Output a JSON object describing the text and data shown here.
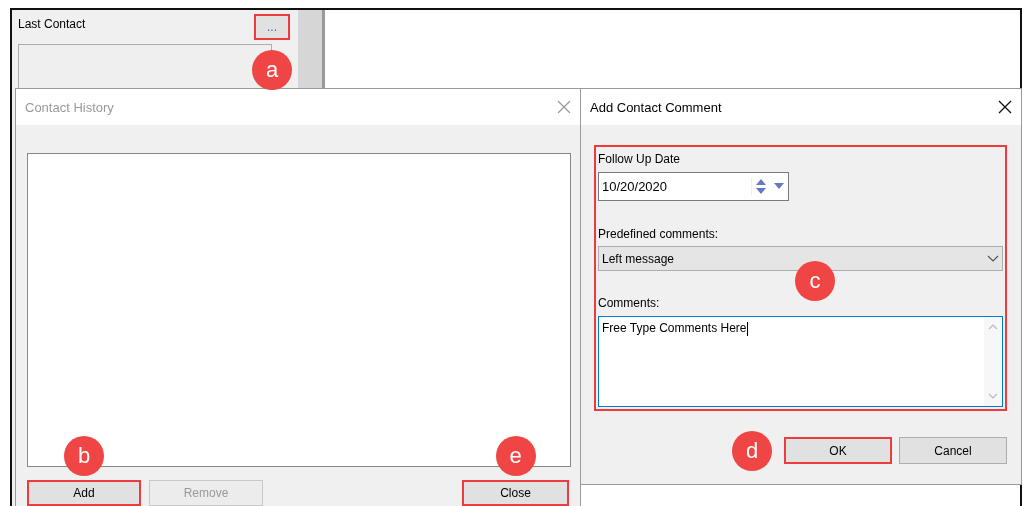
{
  "background_window": {
    "last_contact": {
      "label": "Last Contact",
      "button": {
        "label": "...",
        "highlighted": true,
        "callout": "a"
      }
    }
  },
  "contact_history": {
    "title": "Contact History",
    "buttons": [
      {
        "label": "Add",
        "disabled": false,
        "highlighted": true,
        "callout": "b"
      },
      {
        "label": "Remove",
        "disabled": true,
        "highlighted": false
      },
      {
        "label": "Close",
        "disabled": false,
        "highlighted": true,
        "callout": "e"
      }
    ]
  },
  "add_contact_comment": {
    "title": "Add Contact Comment",
    "fields_group": {
      "highlighted": true,
      "callout": "c"
    },
    "follow_up_date": {
      "label": "Follow Up Date",
      "value": "10/20/2020"
    },
    "predefined_comments": {
      "label": "Predefined comments:",
      "value": "Left message"
    },
    "comments": {
      "label": "Comments:",
      "value": "Free Type Comments Here"
    },
    "buttons": [
      {
        "label": "OK",
        "highlighted": true,
        "callout": "d"
      },
      {
        "label": "Cancel",
        "highlighted": false
      }
    ]
  }
}
